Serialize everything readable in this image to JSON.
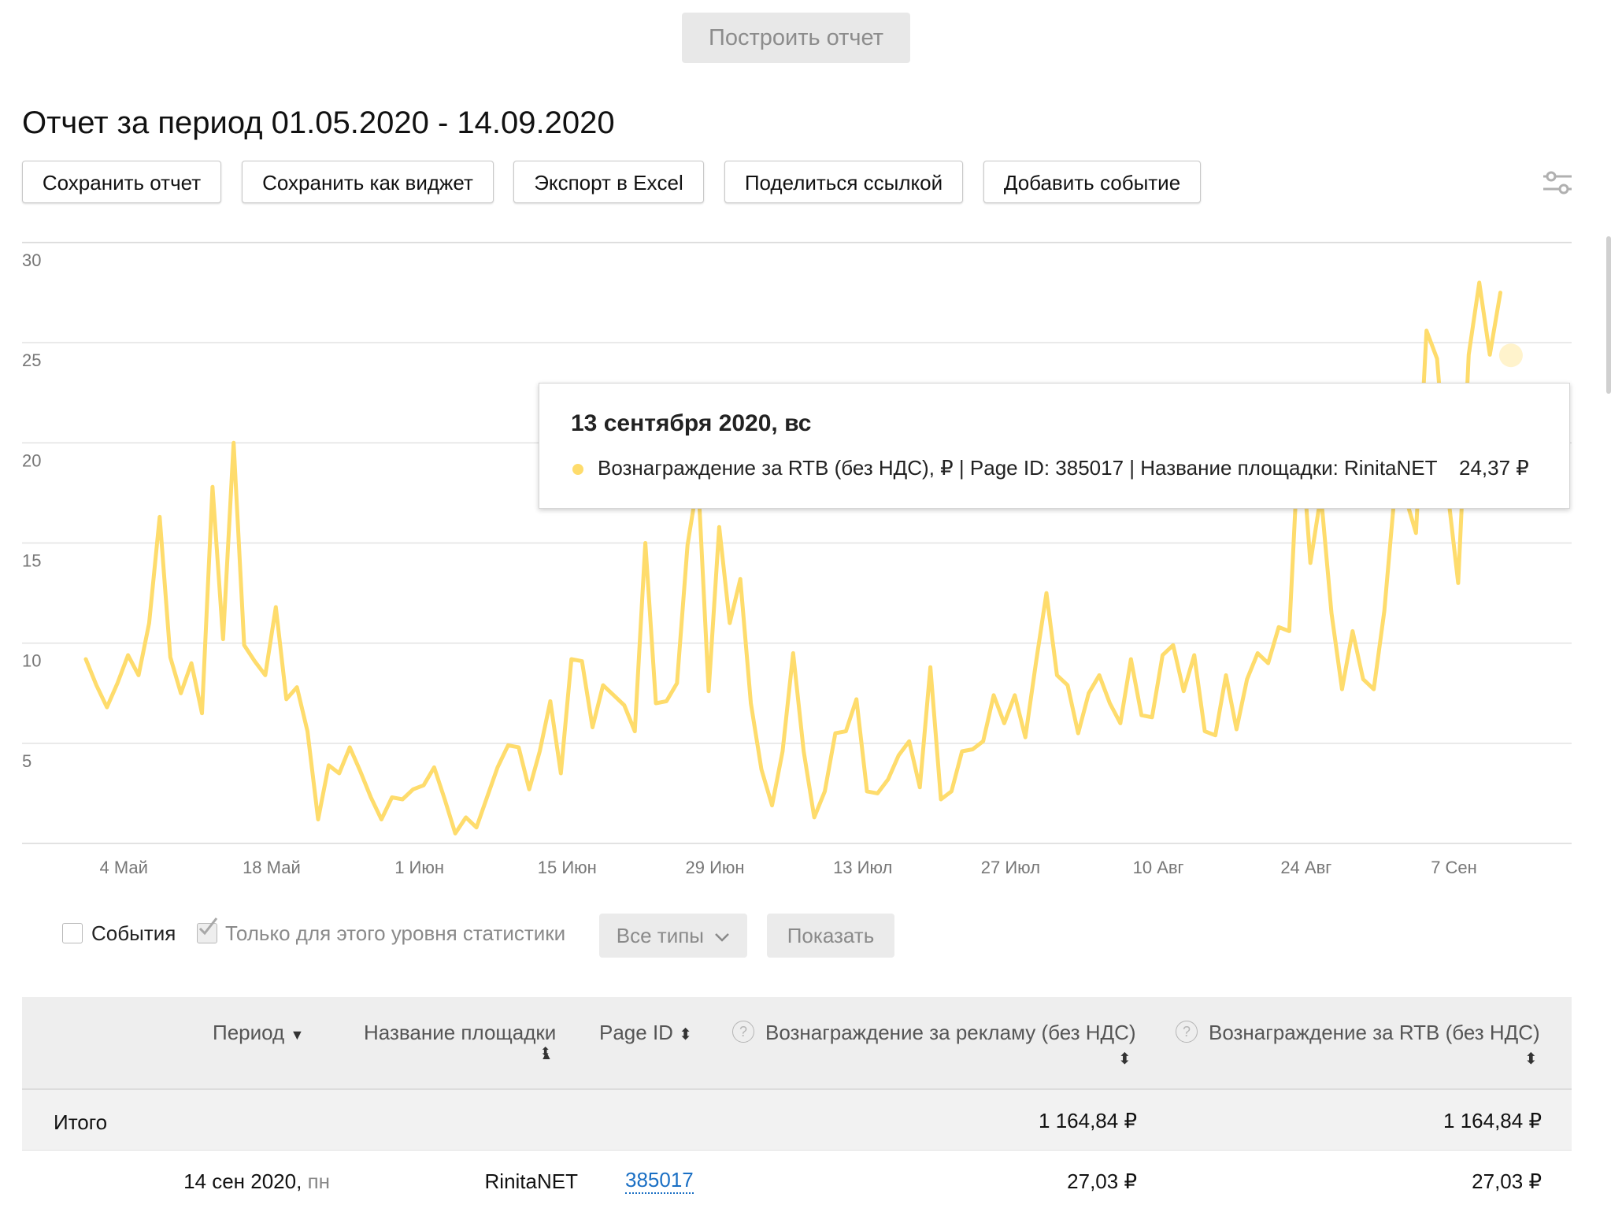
{
  "build_button": "Построить отчет",
  "report_title": "Отчет за период 01.05.2020 - 14.09.2020",
  "actions": {
    "save_report": "Сохранить отчет",
    "save_widget": "Сохранить как виджет",
    "export_excel": "Экспорт в Excel",
    "share_link": "Поделиться ссылкой",
    "add_event": "Добавить событие"
  },
  "chart_data": {
    "type": "line",
    "y_ticks": [
      "30",
      "25",
      "20",
      "15",
      "10",
      "5"
    ],
    "ylim": [
      0,
      30
    ],
    "x_tick_labels": [
      "4 Май",
      "18 Май",
      "1 Июн",
      "15 Июн",
      "29 Июн",
      "13 Июл",
      "27 Июл",
      "10 Авг",
      "24 Авг",
      "7 Сен"
    ],
    "x_start": "2020-05-01",
    "grid": true,
    "series": [
      {
        "name": "Вознаграждение за RTB (без НДС), ₽ | Page ID: 385017 | Название площадки: RinitaNET",
        "color": "#fedc6c",
        "values": [
          9.2,
          7.9,
          6.8,
          8.0,
          9.4,
          8.4,
          11.0,
          16.3,
          9.3,
          7.5,
          9.0,
          6.5,
          17.8,
          10.2,
          20.0,
          9.9,
          9.1,
          8.4,
          11.8,
          7.2,
          7.8,
          5.6,
          1.2,
          3.9,
          3.5,
          4.8,
          3.6,
          2.3,
          1.2,
          2.3,
          2.2,
          2.7,
          2.9,
          3.8,
          2.2,
          0.5,
          1.3,
          0.8,
          2.3,
          3.8,
          4.9,
          4.8,
          2.7,
          4.6,
          7.1,
          3.5,
          9.2,
          9.1,
          5.8,
          7.9,
          7.4,
          6.9,
          5.6,
          15.0,
          7.0,
          7.1,
          8.0,
          14.9,
          18.2,
          7.6,
          15.8,
          11.0,
          13.2,
          7.0,
          3.7,
          1.9,
          4.6,
          9.5,
          4.6,
          1.3,
          2.6,
          5.5,
          5.6,
          7.2,
          2.6,
          2.5,
          3.2,
          4.4,
          5.1,
          2.8,
          8.8,
          2.2,
          2.6,
          4.6,
          4.7,
          5.1,
          7.4,
          6.0,
          7.4,
          5.3,
          9.0,
          12.5,
          8.4,
          7.9,
          5.5,
          7.5,
          8.4,
          7.0,
          6.0,
          9.2,
          6.4,
          6.3,
          9.4,
          9.9,
          7.6,
          9.4,
          5.6,
          5.4,
          8.4,
          5.7,
          8.2,
          9.5,
          9.0,
          10.8,
          10.6,
          21.3,
          14.0,
          17.4,
          11.5,
          7.7,
          10.6,
          8.2,
          7.7,
          11.6,
          17.6,
          17.3,
          15.5,
          25.6,
          24.2,
          17.6,
          13.0,
          24.4,
          28.0,
          24.4,
          27.5
        ]
      }
    ],
    "highlight": {
      "index": 135,
      "value": 24.37
    }
  },
  "tooltip": {
    "date": "13 сентября 2020, вс",
    "series_label": "Вознаграждение за RTB (без НДС), ₽ | Page ID: 385017 | Название площадки: RinitaNET",
    "value": "24,37 ₽"
  },
  "controls": {
    "events_label": "События",
    "this_level_label": "Только для этого уровня статистики",
    "all_types": "Все типы",
    "show": "Показать"
  },
  "table": {
    "headers": {
      "period": "Период",
      "site_name": "Название площадки",
      "page_id": "Page ID",
      "ad_reward": "Вознаграждение за рекламу (без НДС)",
      "rtb_reward": "Вознаграждение за RTB (без НДС)"
    },
    "total": {
      "label": "Итого",
      "ad_reward": "1 164,84 ₽",
      "rtb_reward": "1 164,84 ₽"
    },
    "rows": [
      {
        "date": "14 сен 2020,",
        "weekday": "пн",
        "site_name": "RinitaNET",
        "page_id": "385017",
        "ad_reward": "27,03 ₽",
        "rtb_reward": "27,03 ₽"
      }
    ]
  }
}
